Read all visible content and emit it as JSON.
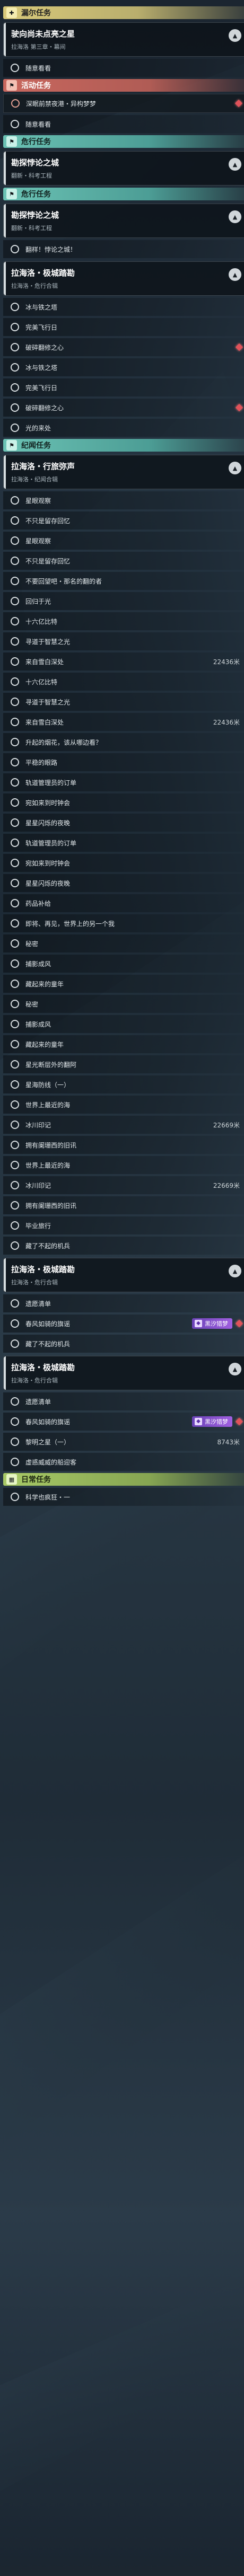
{
  "theme": {
    "accent_red": "#e0525a",
    "mech_purple": "#8a4fd0"
  },
  "section1": {
    "icon": "plus-icon",
    "label": "漏尔任务"
  },
  "card1": {
    "title": "驶向尚未点亮之星",
    "sub": "拉海洛 第三章・幕间"
  },
  "rows1": [
    "随意看看",
    "随意看看"
  ],
  "section2": {
    "icon": "flag-icon",
    "label": "活动任务"
  },
  "activity": {
    "label": "深眠前禁夜港・异构梦梦"
  },
  "rows2": [
    "随意看看"
  ],
  "section3": {
    "icon": "flag-icon",
    "label": "危行任务"
  },
  "card3": {
    "title": "勘探悖论之城",
    "sub": "翻新・科考工程"
  },
  "section4": {
    "icon": "flag-icon",
    "label": "危行任务"
  },
  "card4": {
    "title": "勘探悖论之城",
    "sub": "翻新・科考工程"
  },
  "rows4": [
    "翻样！悖论之城！"
  ],
  "card5": {
    "title": "拉海洛・极城踏勘",
    "sub": "拉海洛・危行合辑"
  },
  "rows5": [
    "冰与铁之塔",
    "完美飞行日",
    "破碎翻修之心",
    "冰与铁之塔",
    "完美飞行日",
    "破碎翻修之心",
    "光的来处"
  ],
  "section6": {
    "icon": "flag-icon",
    "label": "纪闻任务"
  },
  "card6": {
    "title": "拉海洛・行旅弥声",
    "sub": "拉海洛・纪闻合辑"
  },
  "rows6": [
    {
      "t": "星眼观察"
    },
    {
      "t": "不只是留存回忆"
    },
    {
      "t": "星眼观察"
    },
    {
      "t": "不只是留存回忆"
    },
    {
      "t": "不要回望吧・那名的翻的者"
    },
    {
      "t": "回归于光"
    },
    {
      "t": "十六亿比特"
    },
    {
      "t": "寻道于智慧之光"
    },
    {
      "t": "来自雪白深处",
      "r": "22436米"
    },
    {
      "t": "十六亿比特"
    },
    {
      "t": "寻道于智慧之光"
    },
    {
      "t": "来自雪白深处",
      "r": "22436米"
    },
    {
      "t": "升起的烟花，该从哪边看？"
    },
    {
      "t": "平稳的眼路"
    },
    {
      "t": "轨道管理员的订单"
    },
    {
      "t": "宛如来到时钟会"
    },
    {
      "t": "星星闪烁的夜晚"
    },
    {
      "t": "轨道管理员的订单"
    },
    {
      "t": "宛如来到时钟会"
    },
    {
      "t": "星星闪烁的夜晚"
    },
    {
      "t": "药品补给"
    },
    {
      "t": "即将、再见，世界上的另一个我"
    },
    {
      "t": "秘密"
    },
    {
      "t": "捕影成风"
    },
    {
      "t": "藏起来的童年"
    },
    {
      "t": "秘密"
    },
    {
      "t": "捕影成风"
    },
    {
      "t": "藏起来的童年"
    },
    {
      "t": "星光断层外的翻阿"
    },
    {
      "t": "星海防线（一）"
    },
    {
      "t": "世界上最近的海"
    },
    {
      "t": "冰川印记",
      "r": "22669米"
    },
    {
      "t": "拥有阑珊西的旧讯"
    },
    {
      "t": "世界上最近的海"
    },
    {
      "t": "冰川印记",
      "r": "22669米"
    },
    {
      "t": "拥有阑珊西的旧讯"
    },
    {
      "t": "毕业旅行"
    },
    {
      "t": "藏了不起的机兵"
    }
  ],
  "card7": {
    "title": "拉海洛・极城踏勘",
    "sub": "拉海洛・危行合辑"
  },
  "rows7": [
    {
      "t": "遗愿清单"
    },
    {
      "t": "春风如骑的旗谣",
      "badge": "黑汐猎梦"
    },
    {
      "t": "藏了不起的机兵"
    }
  ],
  "card8": {
    "title": "拉海洛・极城踏勘",
    "sub": "拉海洛・危行合辑"
  },
  "rows8": [
    {
      "t": "遗愿清单"
    },
    {
      "t": "春风如骑的旗谣",
      "badge": "黑汐猎梦"
    },
    {
      "t": "黎明之星（一）",
      "r": "8743米"
    },
    {
      "t": "虚惑威威的船迎客"
    }
  ],
  "section9": {
    "icon": "calendar-icon",
    "label": "日常任务"
  },
  "rows9": [
    "科学也疯狂・一"
  ]
}
